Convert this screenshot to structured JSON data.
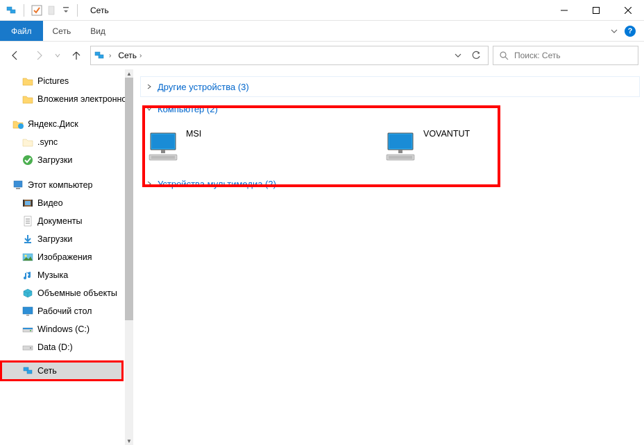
{
  "window": {
    "title": "Сеть"
  },
  "ribbon": {
    "file": "Файл",
    "tabs": [
      "Сеть",
      "Вид"
    ]
  },
  "address": {
    "crumb": "Сеть"
  },
  "search": {
    "placeholder": "Поиск: Сеть"
  },
  "sidebar": {
    "items": [
      {
        "label": "Pictures",
        "icon": "folder",
        "indent": 1
      },
      {
        "label": "Вложения электронной почты",
        "icon": "folder",
        "indent": 1
      },
      {
        "label": "Яндекс.Диск",
        "icon": "yandex",
        "indent": 0,
        "root": true
      },
      {
        "label": ".sync",
        "icon": "folder-light",
        "indent": 1
      },
      {
        "label": "Загрузки",
        "icon": "check",
        "indent": 1
      },
      {
        "label": "Этот компьютер",
        "icon": "pc",
        "indent": 0,
        "root": true
      },
      {
        "label": "Видео",
        "icon": "video",
        "indent": 1
      },
      {
        "label": "Документы",
        "icon": "doc",
        "indent": 1
      },
      {
        "label": "Загрузки",
        "icon": "download",
        "indent": 1
      },
      {
        "label": "Изображения",
        "icon": "image",
        "indent": 1
      },
      {
        "label": "Музыка",
        "icon": "music",
        "indent": 1
      },
      {
        "label": "Объемные объекты",
        "icon": "cube",
        "indent": 1
      },
      {
        "label": "Рабочий стол",
        "icon": "desktop",
        "indent": 1
      },
      {
        "label": "Windows (C:)",
        "icon": "drive",
        "indent": 1
      },
      {
        "label": "Data (D:)",
        "icon": "drive-plain",
        "indent": 1
      },
      {
        "label": "Сеть",
        "icon": "network",
        "indent": 0,
        "root": true,
        "selected": true
      }
    ]
  },
  "content": {
    "sections": [
      {
        "label": "Другие устройства (3)",
        "expanded": false
      },
      {
        "label": "Компьютер (2)",
        "expanded": true
      },
      {
        "label": "Устройства мультимедиа (2)",
        "expanded": false
      }
    ],
    "computers": [
      {
        "name": "MSI"
      },
      {
        "name": "VOVANTUT"
      }
    ]
  }
}
